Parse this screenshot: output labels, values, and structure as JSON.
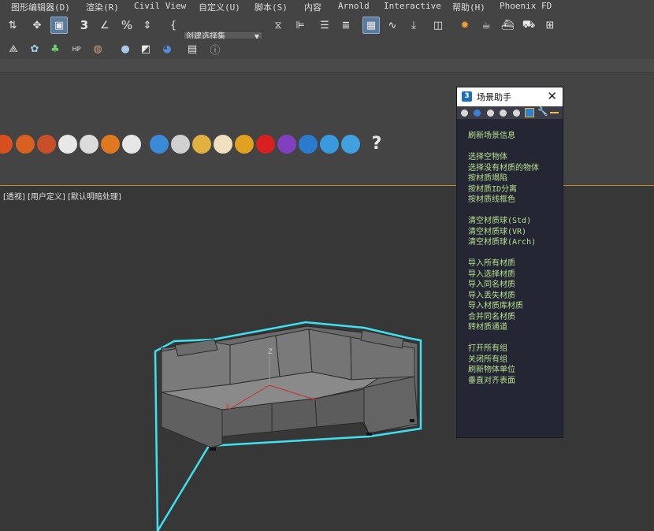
{
  "menubar": {
    "items": [
      "图形编辑器(D)",
      "渲染(R)",
      "Civil View",
      "自定义(U)",
      "脚本(S)",
      "内容",
      "Arnold",
      "Interactive",
      "帮助(H)",
      "Phoenix FD"
    ]
  },
  "toolbar": {
    "selection_set_placeholder": "创建选择集"
  },
  "viewport": {
    "label": "[透视] [用户定义] [默认明暗处理]",
    "axis_z": "Z",
    "axis_x": "X"
  },
  "scene_helper": {
    "title": "场景助手",
    "close": "✕",
    "logo": "3",
    "groups": [
      [
        "刷新场景信息"
      ],
      [
        "选择空物体",
        "选择没有材质的物体",
        "按材质塌陷",
        "按材质ID分离",
        "按材质线框色"
      ],
      [
        "清空材质球(Std)",
        "清空材质球(VR)",
        "清空材质球(Arch)"
      ],
      [
        "导入所有材质",
        "导入选择材质",
        "导入同名材质",
        "导入丢失材质",
        "导入材质库材质",
        "合并同名材质",
        "转材质通道"
      ],
      [
        "打开所有组",
        "关闭所有组",
        "刷新物体单位",
        "垂直对齐表面"
      ]
    ]
  },
  "colors": {
    "accent_orange": "#c08a2a",
    "selection_outline": "#3fe0f0",
    "helper_text": "#b7e08e",
    "helper_bg": "#252634"
  }
}
